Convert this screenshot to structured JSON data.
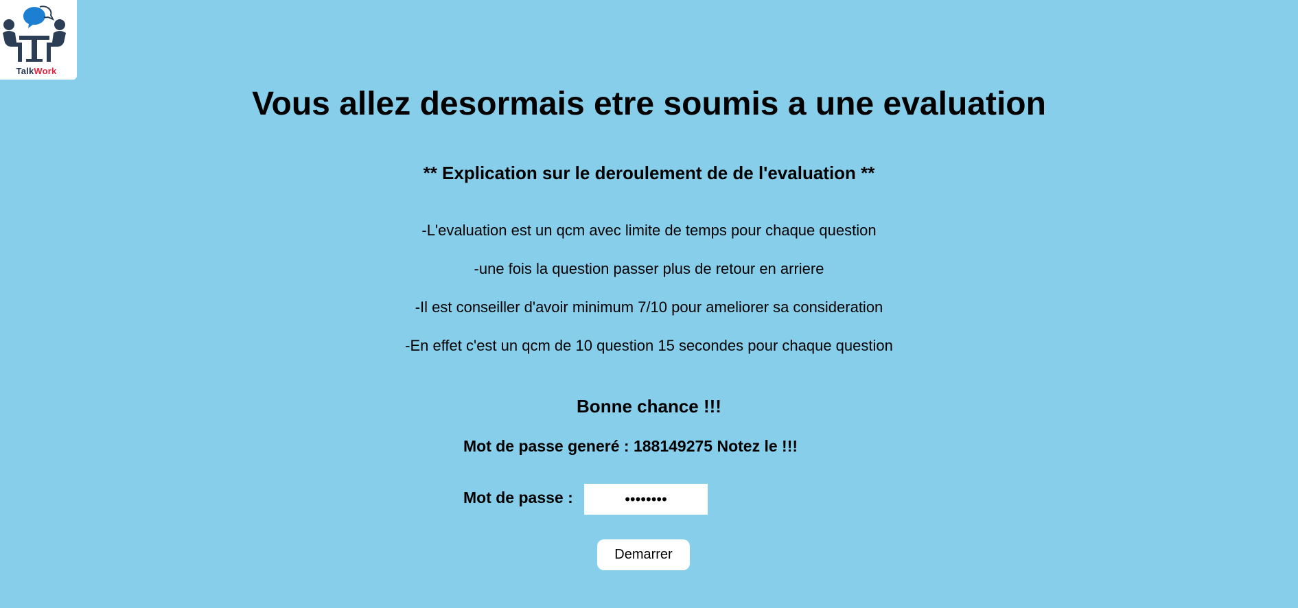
{
  "logo": {
    "brand_part1": "Talk",
    "brand_part2": "Work",
    "icon": "meeting-people-icon",
    "colors": {
      "dark": "#2c3e55",
      "accent": "#e8253d",
      "bubble": "#1d7fd1"
    }
  },
  "header": {
    "title": "Vous allez desormais etre soumis a une evaluation"
  },
  "instructions": {
    "heading": "** Explication sur le deroulement de de l'evaluation **",
    "items": [
      "-L'evaluation est un qcm avec limite de temps pour chaque question",
      "-une fois la question passer plus de retour en arriere",
      "-Il est conseiller d'avoir minimum 7/10 pour ameliorer sa consideration",
      "-En effet c'est un qcm de 10 question 15 secondes pour chaque question"
    ],
    "closing": "Bonne chance !!!"
  },
  "password": {
    "generated_text": "Mot de passe generé : 188149275 Notez le !!!",
    "label": "Mot de passe :",
    "value": "••••••••"
  },
  "actions": {
    "start_label": "Demarrer"
  },
  "theme": {
    "background": "#87ceeb",
    "surface": "#ffffff"
  }
}
